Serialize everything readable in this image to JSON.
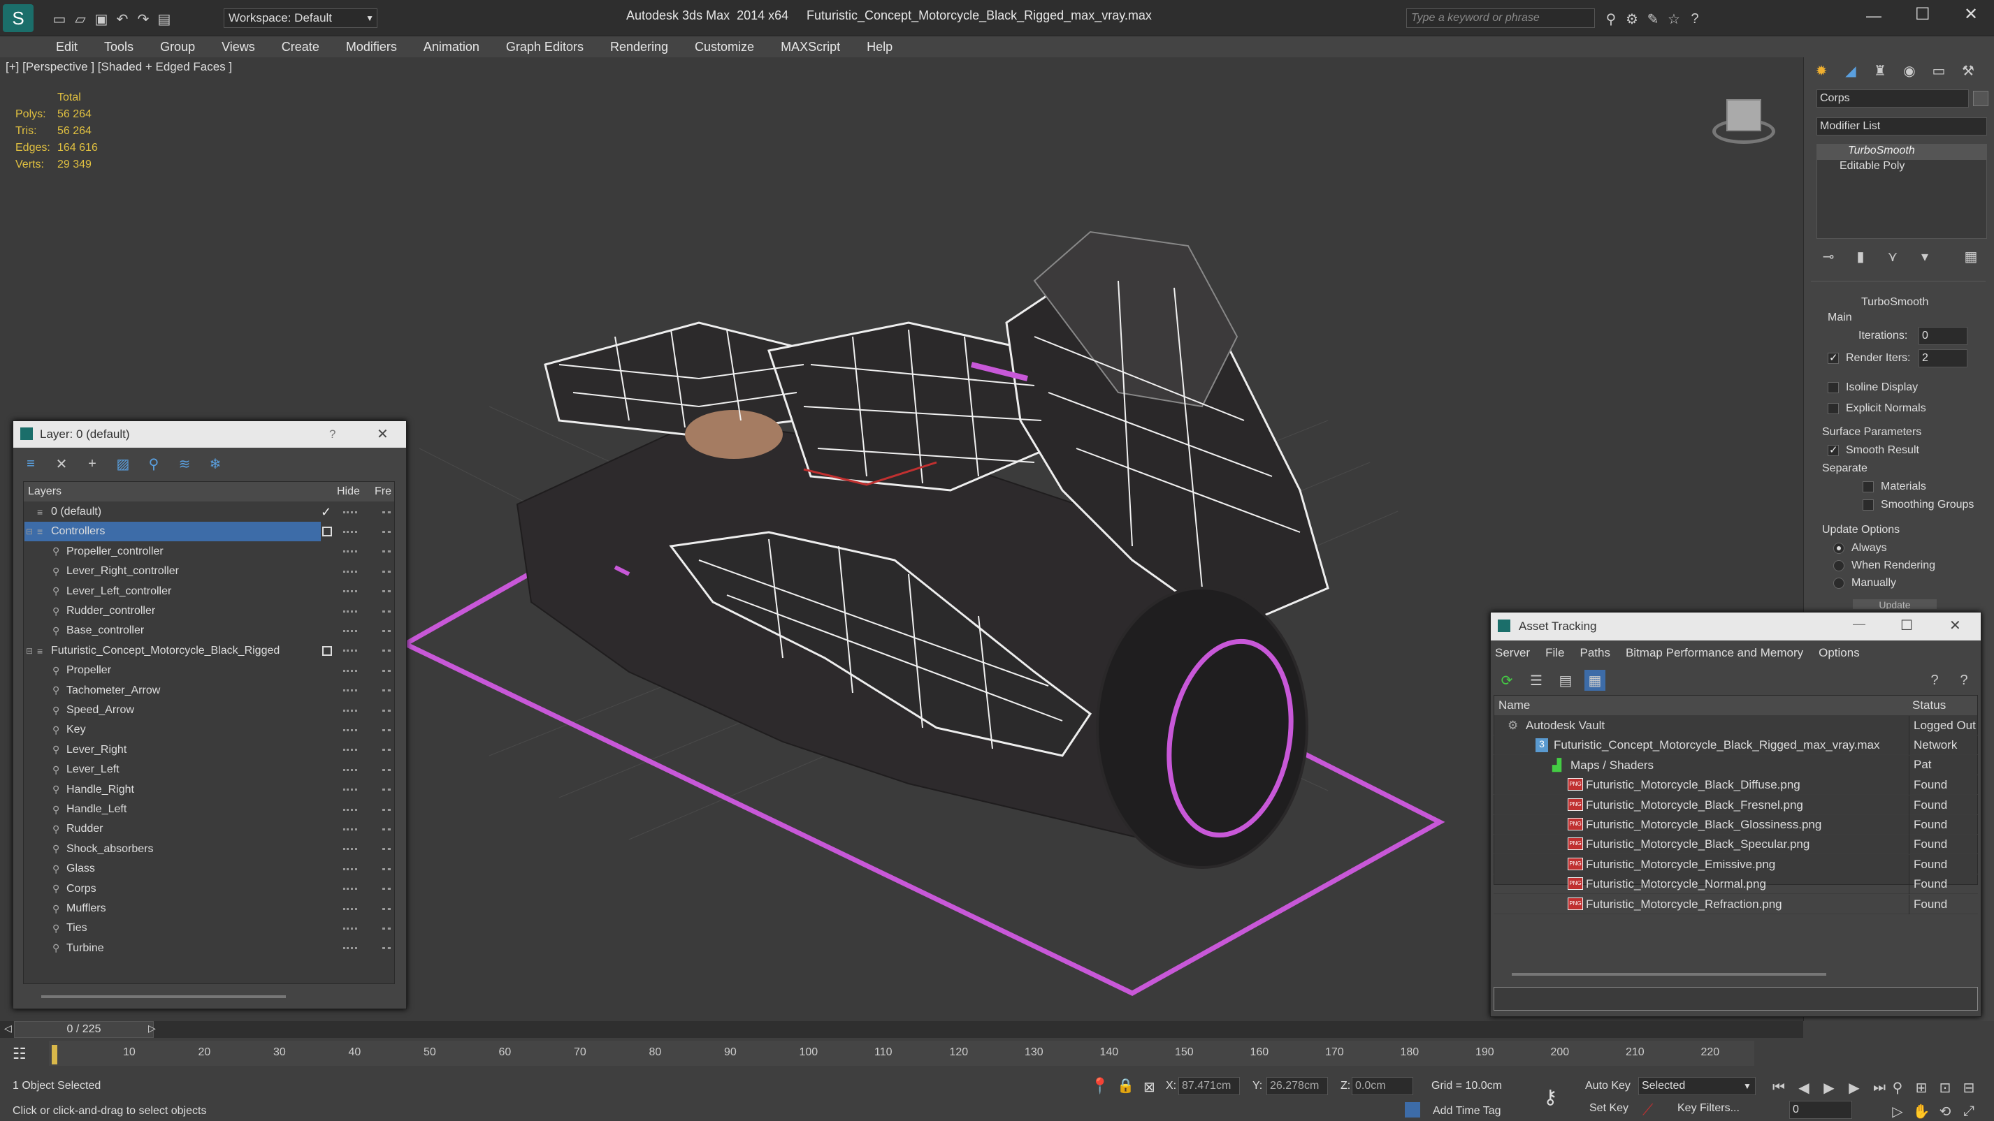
{
  "titlebar": {
    "workspace": "Workspace: Default",
    "app_title": "Autodesk 3ds Max  2014 x64",
    "file_title": "Futuristic_Concept_Motorcycle_Black_Rigged_max_vray.max",
    "search_placeholder": "Type a keyword or phrase"
  },
  "menu": [
    "Edit",
    "Tools",
    "Group",
    "Views",
    "Create",
    "Modifiers",
    "Animation",
    "Graph Editors",
    "Rendering",
    "Customize",
    "MAXScript",
    "Help"
  ],
  "viewport": {
    "label": "[+] [Perspective ] [Shaded + Edged Faces ]",
    "stats": {
      "header": "Total",
      "rows": [
        {
          "label": "Polys:",
          "value": "56 264"
        },
        {
          "label": "Tris:",
          "value": "56 264"
        },
        {
          "label": "Edges:",
          "value": "164 616"
        },
        {
          "label": "Verts:",
          "value": "29 349"
        }
      ]
    }
  },
  "command_panel": {
    "object_name": "Corps",
    "modifier_list": "Modifier List",
    "stack": [
      "TurboSmooth",
      "Editable Poly"
    ],
    "rollout_title": "TurboSmooth",
    "main_label": "Main",
    "iterations_label": "Iterations:",
    "iterations_value": "0",
    "render_iters_label": "Render Iters:",
    "render_iters_value": "2",
    "isoline": "Isoline Display",
    "explicit": "Explicit Normals",
    "surface_params": "Surface Parameters",
    "smooth_result": "Smooth Result",
    "separate": "Separate",
    "materials": "Materials",
    "smoothing_groups": "Smoothing Groups",
    "update_options": "Update Options",
    "always": "Always",
    "when_rendering": "When Rendering",
    "manually": "Manually",
    "update_btn": "Update"
  },
  "layer_window": {
    "title": "Layer: 0 (default)",
    "help": "?",
    "col_layers": "Layers",
    "col_hide": "Hide",
    "col_freeze": "Fre",
    "rows": [
      {
        "name": "0 (default)",
        "level": 0
      },
      {
        "name": "Controllers",
        "level": 0
      },
      {
        "name": "Propeller_controller",
        "level": 1
      },
      {
        "name": "Lever_Right_controller",
        "level": 1
      },
      {
        "name": "Lever_Left_controller",
        "level": 1
      },
      {
        "name": "Rudder_controller",
        "level": 1
      },
      {
        "name": "Base_controller",
        "level": 1
      },
      {
        "name": "Futuristic_Concept_Motorcycle_Black_Rigged",
        "level": 0
      },
      {
        "name": "Propeller",
        "level": 1
      },
      {
        "name": "Tachometer_Arrow",
        "level": 1
      },
      {
        "name": "Speed_Arrow",
        "level": 1
      },
      {
        "name": "Key",
        "level": 1
      },
      {
        "name": "Lever_Right",
        "level": 1
      },
      {
        "name": "Lever_Left",
        "level": 1
      },
      {
        "name": "Handle_Right",
        "level": 1
      },
      {
        "name": "Handle_Left",
        "level": 1
      },
      {
        "name": "Rudder",
        "level": 1
      },
      {
        "name": "Shock_absorbers",
        "level": 1
      },
      {
        "name": "Glass",
        "level": 1
      },
      {
        "name": "Corps",
        "level": 1
      },
      {
        "name": "Mufflers",
        "level": 1
      },
      {
        "name": "Ties",
        "level": 1
      },
      {
        "name": "Turbine",
        "level": 1
      }
    ]
  },
  "asset_window": {
    "title": "Asset Tracking",
    "menu": [
      "Server",
      "File",
      "Paths",
      "Bitmap Performance and Memory",
      "Options"
    ],
    "col_name": "Name",
    "col_status": "Status",
    "rows": [
      {
        "name": "Autodesk Vault",
        "status": "Logged Out"
      },
      {
        "name": "Futuristic_Concept_Motorcycle_Black_Rigged_max_vray.max",
        "status": "Network Pat"
      },
      {
        "name": "Maps / Shaders",
        "status": ""
      },
      {
        "name": "Futuristic_Motorcycle_Black_Diffuse.png",
        "status": "Found"
      },
      {
        "name": "Futuristic_Motorcycle_Black_Fresnel.png",
        "status": "Found"
      },
      {
        "name": "Futuristic_Motorcycle_Black_Glossiness.png",
        "status": "Found"
      },
      {
        "name": "Futuristic_Motorcycle_Black_Specular.png",
        "status": "Found"
      },
      {
        "name": "Futuristic_Motorcycle_Emissive.png",
        "status": "Found"
      },
      {
        "name": "Futuristic_Motorcycle_Normal.png",
        "status": "Found"
      },
      {
        "name": "Futuristic_Motorcycle_Refraction.png",
        "status": "Found"
      }
    ]
  },
  "timeline": {
    "frame": "0 / 225",
    "ticks": [
      "10",
      "20",
      "30",
      "40",
      "50",
      "60",
      "70",
      "80",
      "90",
      "100",
      "110",
      "120",
      "130",
      "140",
      "150",
      "160",
      "170",
      "180",
      "190",
      "200",
      "210",
      "220"
    ]
  },
  "status": {
    "selection": "1 Object Selected",
    "prompt": "Click or click-and-drag to select objects",
    "x_label": "X:",
    "x_value": "87.471cm",
    "y_label": "Y:",
    "y_value": "26.278cm",
    "z_label": "Z:",
    "z_value": "0.0cm",
    "grid": "Grid = 10.0cm",
    "add_time_tag": "Add Time Tag",
    "auto_key": "Auto Key",
    "set_key": "Set Key",
    "selected": "Selected",
    "key_filters": "Key Filters...",
    "frame_field": "0"
  }
}
